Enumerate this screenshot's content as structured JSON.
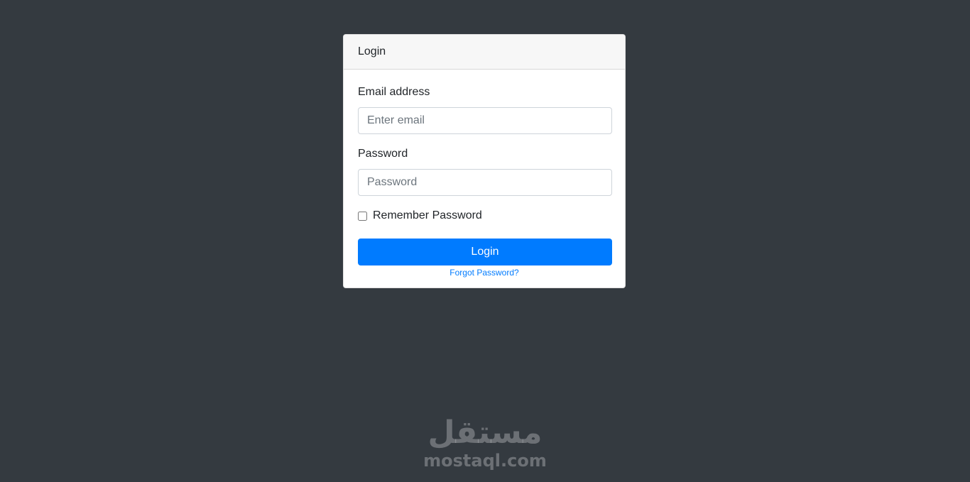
{
  "card": {
    "header_title": "Login"
  },
  "form": {
    "email_label": "Email address",
    "email_placeholder": "Enter email",
    "email_value": "",
    "password_label": "Password",
    "password_placeholder": "Password",
    "password_value": "",
    "remember_label": "Remember Password",
    "remember_checked": false,
    "submit_label": "Login",
    "forgot_link": "Forgot Password?"
  },
  "watermark": {
    "logo_text": "مستقل",
    "domain": "mostaql.com"
  },
  "colors": {
    "page_background": "#343a40",
    "primary": "#007bff",
    "card_header": "#f7f7f7"
  }
}
